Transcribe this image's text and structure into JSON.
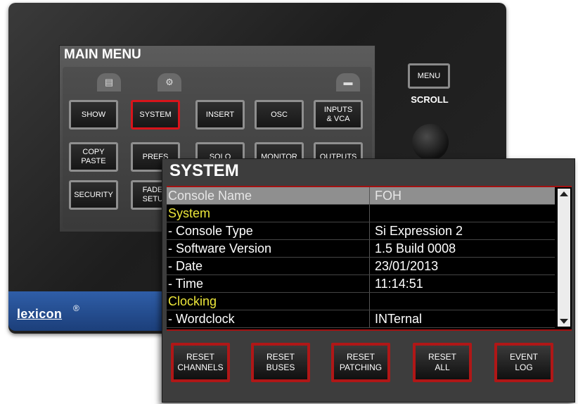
{
  "brand": {
    "logo": "lexicon",
    "reg": "®"
  },
  "main_menu": {
    "title": "MAIN MENU",
    "tabs": [
      {
        "icon": "list-icon",
        "glyph": "▤"
      },
      {
        "icon": "gears-icon",
        "glyph": "⚙"
      },
      {
        "icon": "console-icon",
        "glyph": "▬"
      }
    ],
    "buttons": [
      {
        "label": "SHOW",
        "selected": false
      },
      {
        "label": "SYSTEM",
        "selected": true
      },
      {
        "label": "INSERT",
        "selected": false
      },
      {
        "label": "OSC",
        "selected": false
      },
      {
        "label": "INPUTS\n& VCA",
        "selected": false
      },
      {
        "label": "COPY\nPASTE",
        "selected": false
      },
      {
        "label": "PREFS",
        "selected": false
      },
      {
        "label": "SOLO",
        "selected": false
      },
      {
        "label": "MONITOR",
        "selected": false
      },
      {
        "label": "OUTPUTS",
        "selected": false
      },
      {
        "label": "SECURITY",
        "selected": false
      },
      {
        "label": "FADER\nSETUP",
        "selected": false
      }
    ]
  },
  "hardware": {
    "menu_button": "MENU",
    "scroll_label": "SCROLL"
  },
  "system": {
    "title": "SYSTEM",
    "rows": [
      {
        "key": "Console Name",
        "value": "FOH",
        "type": "highlight"
      },
      {
        "key": "System",
        "value": "",
        "type": "section"
      },
      {
        "key": "- Console Type",
        "value": "Si Expression 2",
        "type": "item"
      },
      {
        "key": "- Software Version",
        "value": "1.5 Build 0008",
        "type": "item"
      },
      {
        "key": "- Date",
        "value": "23/01/2013",
        "type": "item"
      },
      {
        "key": "- Time",
        "value": "11:14:51",
        "type": "item"
      },
      {
        "key": "Clocking",
        "value": "",
        "type": "section"
      },
      {
        "key": "- Wordclock",
        "value": "INTernal",
        "type": "item"
      }
    ],
    "buttons": [
      "RESET\nCHANNELS",
      "RESET\nBUSES",
      "RESET\nPATCHING",
      "RESET\nALL",
      "EVENT\nLOG"
    ]
  },
  "colors": {
    "accent_red": "#d8141b",
    "section_yellow": "#ece63a",
    "brand_blue": "#2f5ea8"
  }
}
